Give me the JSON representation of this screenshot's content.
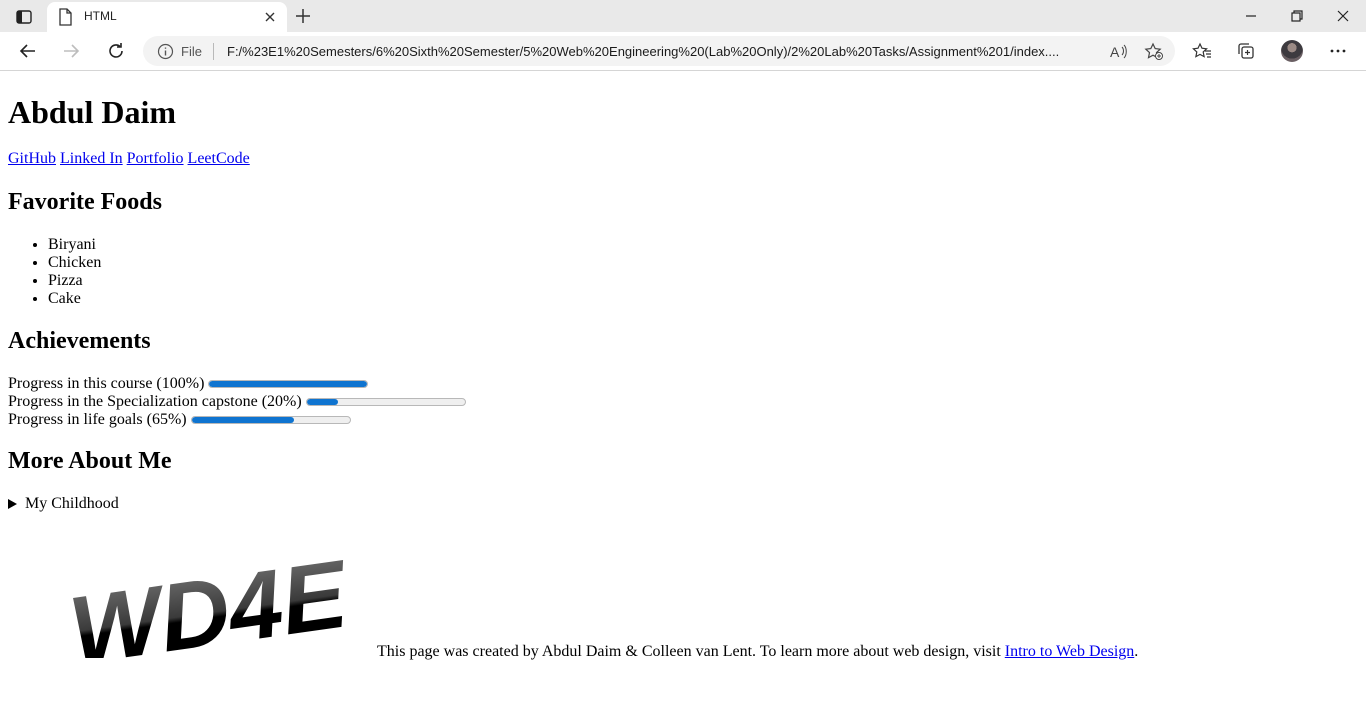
{
  "browser": {
    "tab_title": "HTML",
    "address_prefix": "File",
    "url": "F:/%23E1%20Semesters/6%20Sixth%20Semester/5%20Web%20Engineering%20(Lab%20Only)/2%20Lab%20Tasks/Assignment%201/index...."
  },
  "page": {
    "name": "Abdul Daim",
    "links": [
      "GitHub",
      "Linked In",
      "Portfolio",
      "LeetCode"
    ],
    "foods_heading": "Favorite Foods",
    "foods": [
      "Biryani",
      "Chicken",
      "Pizza",
      "Cake"
    ],
    "achievements_heading": "Achievements",
    "progress": [
      {
        "label": "Progress in this course (100%)",
        "value": 1.0
      },
      {
        "label": "Progress in the Specialization capstone (20%)",
        "value": 0.2
      },
      {
        "label": "Progress in life goals (65%)",
        "value": 0.65
      }
    ],
    "more_heading": "More About Me",
    "details_summary": "My Childhood",
    "logo_text": "WD4E",
    "footer_text": "This page was created by Abdul Daim & Colleen van Lent. To learn more about web design, visit ",
    "footer_link": "Intro to Web Design",
    "footer_end": "."
  },
  "colors": {
    "progress_fill": "#0f74d0",
    "link": "#0000ee"
  }
}
